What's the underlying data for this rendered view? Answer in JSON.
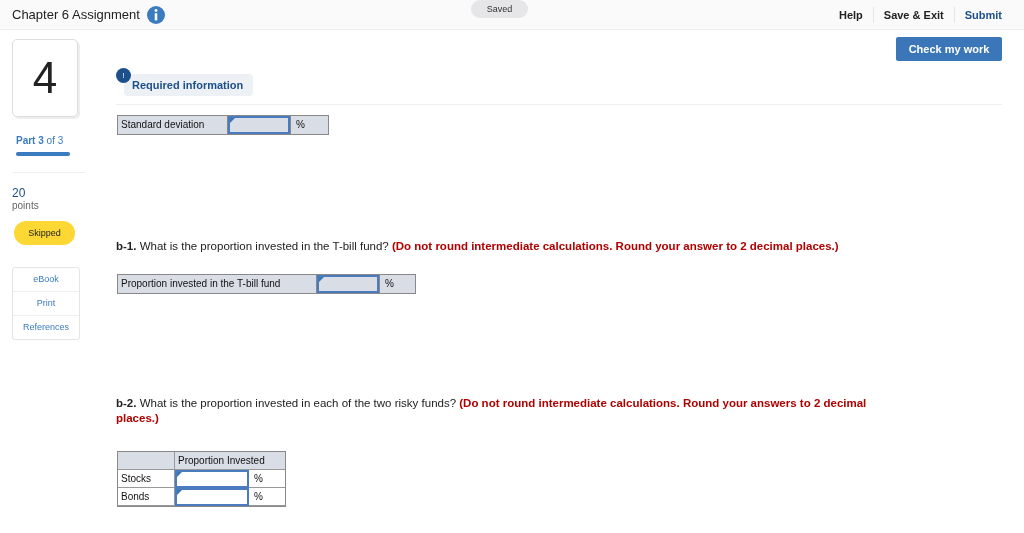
{
  "header": {
    "title": "Chapter 6 Assignment",
    "status": "Saved",
    "actions": [
      {
        "label": "Help",
        "kind": "plain"
      },
      {
        "label": "Save & Exit",
        "kind": "plain"
      },
      {
        "label": "Submit",
        "kind": "primary"
      }
    ]
  },
  "check_button": "Check my work",
  "sidebar": {
    "question_number": "4",
    "part": "**Part 3** of 3",
    "progress": {
      "level": 1
    },
    "points": "20",
    "points_label": "points",
    "status": "Skipped",
    "links": [
      "eBook",
      "Print",
      "References"
    ]
  },
  "required_info": {
    "badge": "!",
    "label": "Required information"
  },
  "info_table": {
    "label": "Standard deviation",
    "unit": "%"
  },
  "questions": [
    {
      "label": "b-1.",
      "text": "What is the proportion invested in the T-bill fund?",
      "instruction": "(Do not round intermediate calculations. Round your answer to 2 decimal places.)",
      "table": {
        "kind": "single",
        "label": "Proportion invested in the T-bill fund",
        "unit": "%"
      }
    },
    {
      "label": "b-2.",
      "text": "What is the proportion invested in each of the two risky funds?",
      "instruction": "(Do not round intermediate calculations. Round your answers to 2 decimal places.)",
      "table": {
        "kind": "grid",
        "header": "Proportion Invested",
        "rows": [
          {
            "label": "Stocks",
            "unit": "%"
          },
          {
            "label": "Bonds",
            "unit": "%"
          }
        ]
      }
    }
  ]
}
